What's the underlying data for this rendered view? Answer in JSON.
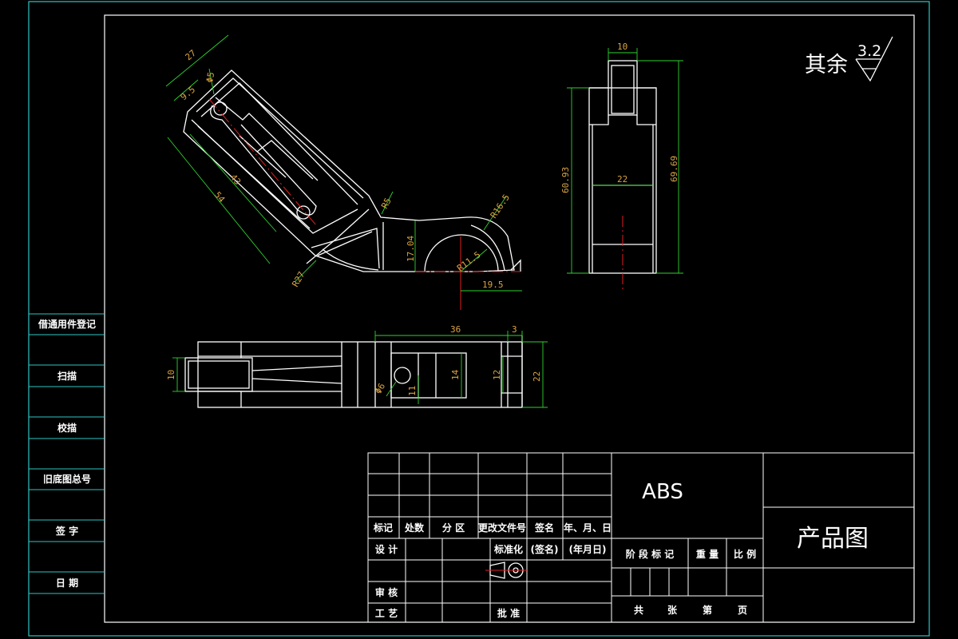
{
  "title_block": {
    "material": "ABS",
    "drawing_name": "产品图",
    "rev_headers": [
      "标记",
      "处数",
      "分 区",
      "更改文件号",
      "签名",
      "年、月、日"
    ],
    "design": "设 计",
    "standardization": "标准化",
    "sign_name": "(签名)",
    "sign_date": "(年月日)",
    "stage_mark": "阶 段 标 记",
    "weight": "重 量",
    "scale": "比 例",
    "review": "审 核",
    "process": "工 艺",
    "approve": "批 准",
    "sheets": "共",
    "sheet_unit": "张",
    "sheet_no": "第",
    "page": "页"
  },
  "side_labels": [
    "借通用件登记",
    "扫描",
    "校描",
    "旧底图总号",
    "签 字",
    "日 期"
  ],
  "roughness": {
    "label": "其余",
    "value": "3.2"
  },
  "dimensions": {
    "angled_view": {
      "d27": "27",
      "d9_5": "9.5",
      "d5": "Φ5",
      "d43": "43",
      "d54": "54",
      "r5": "R5",
      "r16_5": "R16.5",
      "r27": "R27",
      "d17_04": "17.04",
      "r11_5": "R11.5",
      "d19_5": "19.5"
    },
    "right_view": {
      "d10": "10",
      "d60_93": "60.93",
      "d69_69": "69.69",
      "d22": "22"
    },
    "top_view": {
      "d36": "36",
      "d3": "3",
      "d10": "10",
      "d6": "Φ6",
      "d11": "11",
      "d14": "14",
      "d12": "12",
      "d22": "22"
    }
  },
  "colors": {
    "background": "#000000",
    "outline": "#ffffff",
    "dimension_line": "#2fd12f",
    "dimension_text": "#d9a441",
    "center_line": "#e02020",
    "frame_cyan": "#2ec4c4"
  }
}
